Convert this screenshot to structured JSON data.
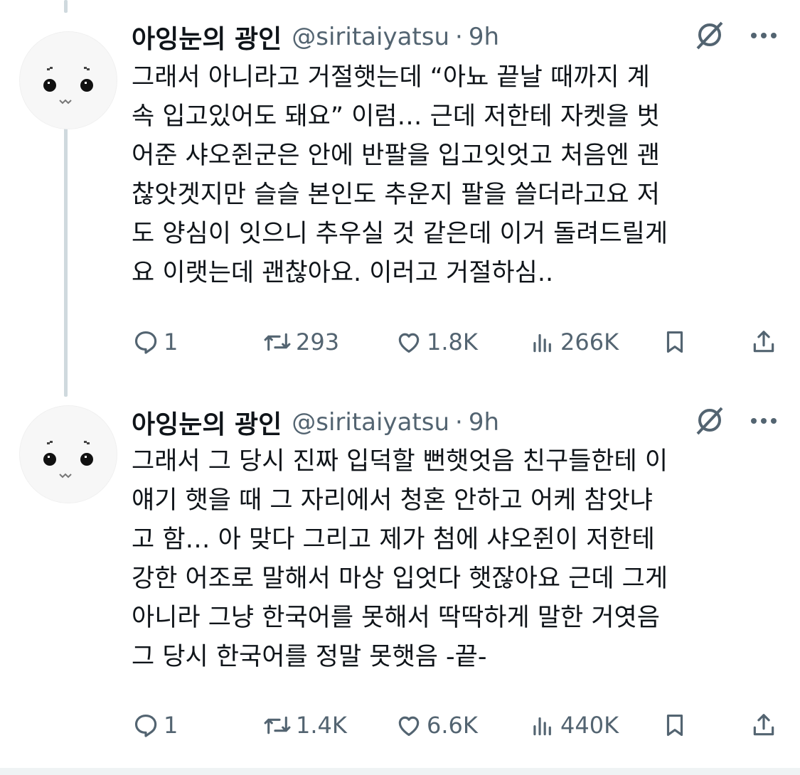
{
  "tweets": [
    {
      "name": "아잉눈의 광인",
      "handle": "@siritaiyatsu",
      "separator": "·",
      "time": "9h",
      "text": "그래서 아니라고 거절햇는데 “아뇨 끝날 때까지 계\n속 입고있어도 돼요” 이럼… 근데 저한테 자켓을 벗\n어준 샤오쥔군은 안에 반팔을 입고잇엇고 처음엔 괜\n찮앗겟지만 슬슬 본인도 추운지 팔을 쓸더라고요 저\n도 양심이 잇으니 추우실 것 같은데 이거 돌려드릴게\n요 이랫는데 괜찮아요. 이러고 거절하심..",
      "replies": "1",
      "reposts": "293",
      "likes": "1.8K",
      "views": "266K"
    },
    {
      "name": "아잉눈의 광인",
      "handle": "@siritaiyatsu",
      "separator": "·",
      "time": "9h",
      "text": "그래서 그 당시 진짜 입덕할 뻔햇엇음 친구들한테 이\n얘기 햇을 때 그 자리에서 청혼 안하고 어케 참앗냐\n고 함… 아 맞다 그리고 제가 첨에 샤오쥔이 저한테\n강한 어조로 말해서 마상 입엇다 햇잖아요 근데 그게\n아니라 그냥 한국어를 못해서 딱딱하게 말한 거엿음\n그 당시 한국어를 정말 못햇음 -끝-",
      "replies": "1",
      "reposts": "1.4K",
      "likes": "6.6K",
      "views": "440K"
    }
  ],
  "icons": {
    "reply": "reply-icon",
    "repost": "repost-icon",
    "like": "heart-icon",
    "views": "views-icon",
    "bookmark": "bookmark-icon",
    "share": "share-icon",
    "grok": "grok-icon",
    "more": "more-icon"
  },
  "colors": {
    "text": "#0f1419",
    "secondary": "#536471",
    "thread_line": "#cfd9de"
  }
}
